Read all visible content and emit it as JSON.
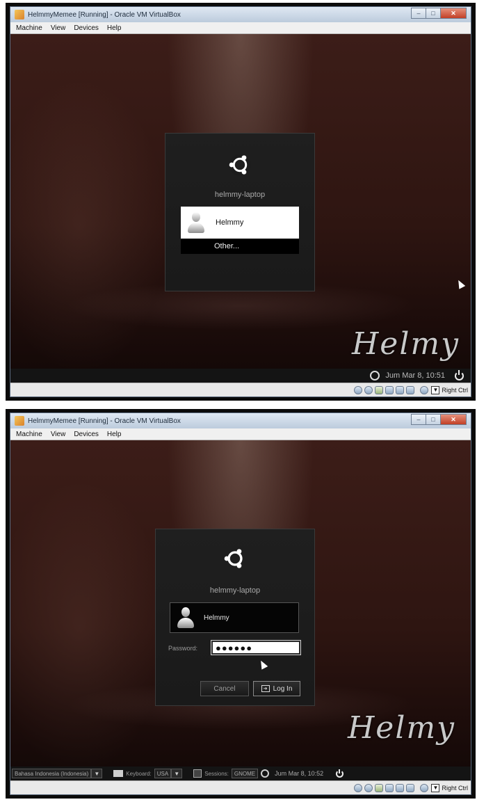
{
  "screenshot1": {
    "window_title": "HelmmyMemee [Running] - Oracle VM VirtualBox",
    "menu": [
      "Machine",
      "View",
      "Devices",
      "Help"
    ],
    "login": {
      "hostname": "helmmy-laptop",
      "users": [
        {
          "name": "Helmmy"
        }
      ],
      "other_label": "Other..."
    },
    "watermark": "Helmy",
    "panel": {
      "clock": "Jum Mar  8, 10:51"
    },
    "statusbar": {
      "host_key": "Right Ctrl"
    }
  },
  "screenshot2": {
    "window_title": "HelmmyMemee [Running] - Oracle VM VirtualBox",
    "menu": [
      "Machine",
      "View",
      "Devices",
      "Help"
    ],
    "login": {
      "hostname": "helmmy-laptop",
      "selected_user": "Helmmy",
      "password_label": "Password:",
      "password_value": "●●●●●●",
      "cancel_label": "Cancel",
      "login_label": "Log In"
    },
    "watermark": "Helmy",
    "panel": {
      "language_value": "Bahasa Indonesia (Indonesia)",
      "keyboard_label": "Keyboard:",
      "keyboard_value": "USA",
      "sessions_label": "Sessions:",
      "sessions_value": "GNOME",
      "clock": "Jum Mar  8, 10:52"
    },
    "statusbar": {
      "host_key": "Right Ctrl"
    }
  }
}
